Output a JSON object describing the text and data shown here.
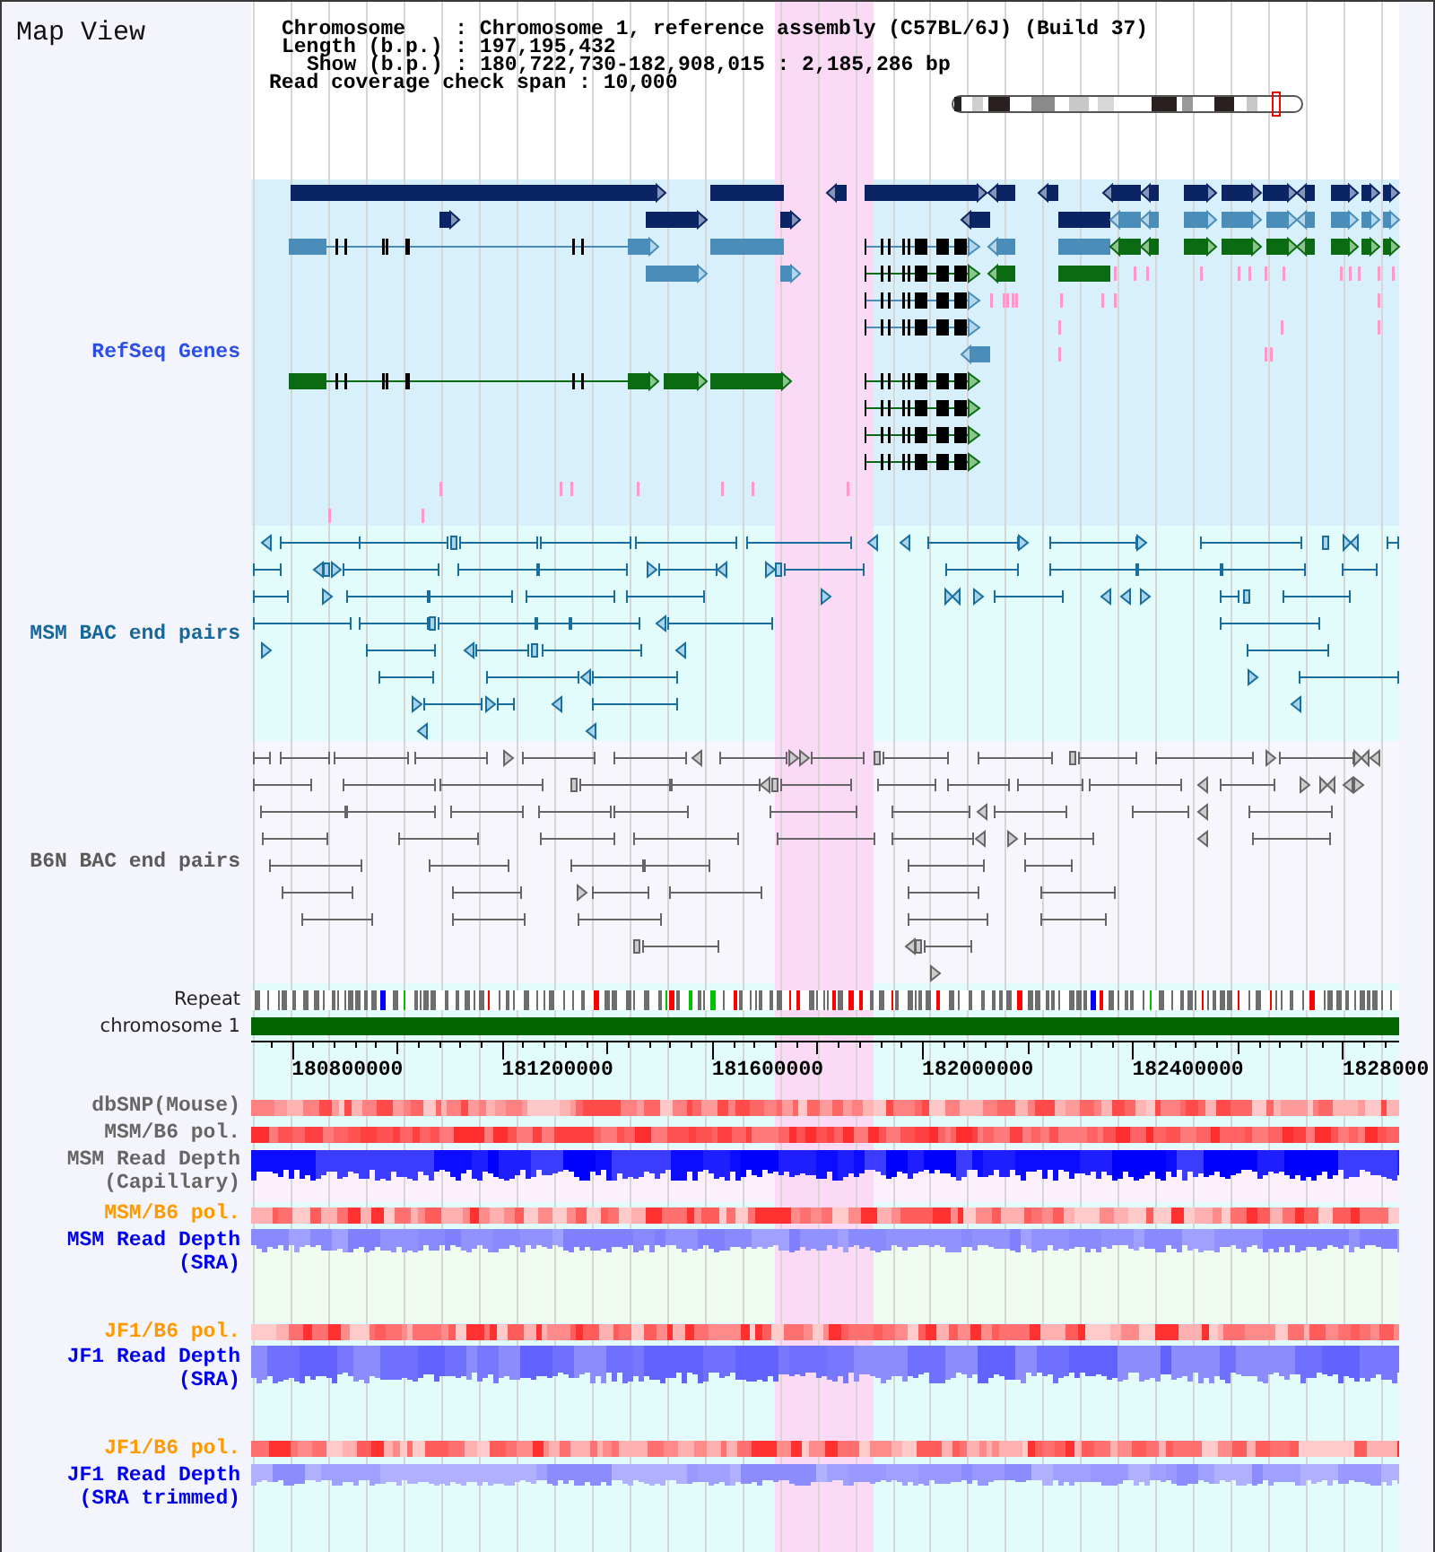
{
  "title": "Map View",
  "info_lines": [
    "Chromosome    : Chromosome 1, reference assembly (C57BL/6J) (Build 37)",
    "Length (b.p.) : 197,195,432",
    "Show (b.p.) : 180,722,730-182,908,015 : 2,185,286 bp",
    "Read coverage check span : 10,000"
  ],
  "tracks": [
    {
      "label": "RefSeq Genes",
      "kind": "genes",
      "color": "#2b4fe6"
    },
    {
      "label": "MSM BAC end pairs",
      "kind": "bac_pairs",
      "color": "#17689a"
    },
    {
      "label": "B6N BAC end pairs",
      "kind": "bac_pairs",
      "color": "#5a5a5a"
    },
    {
      "label": "Repeat",
      "kind": "repeat"
    },
    {
      "label": "chromosome 1",
      "kind": "chromosome"
    }
  ],
  "axis": {
    "ticks": [
      "180800000",
      "181200000",
      "181600000",
      "182000000",
      "182400000",
      "1828000"
    ]
  },
  "data_tracks": [
    {
      "label": "dbSNP(Mouse)",
      "kind": "heatmap",
      "color": "#666666"
    },
    {
      "label": "MSM/B6 pol.",
      "kind": "heatmap",
      "color": "#666666"
    },
    {
      "label": "MSM Read Depth (Capillary)",
      "kind": "depth",
      "color": "#666666"
    },
    {
      "label": "MSM/B6 pol.",
      "kind": "heatmap",
      "color": "#ff9900"
    },
    {
      "label": "MSM Read Depth (SRA)",
      "kind": "depth",
      "color": "#0000ee"
    },
    {
      "label": "JF1/B6 pol.",
      "kind": "heatmap",
      "color": "#ff9900"
    },
    {
      "label": "JF1 Read Depth (SRA)",
      "kind": "depth",
      "color": "#0000ee"
    },
    {
      "label": "JF1/B6 pol.",
      "kind": "heatmap",
      "color": "#ff9900"
    },
    {
      "label": "JF1 Read Depth (SRA trimmed)",
      "kind": "depth",
      "color": "#0000ee"
    }
  ]
}
